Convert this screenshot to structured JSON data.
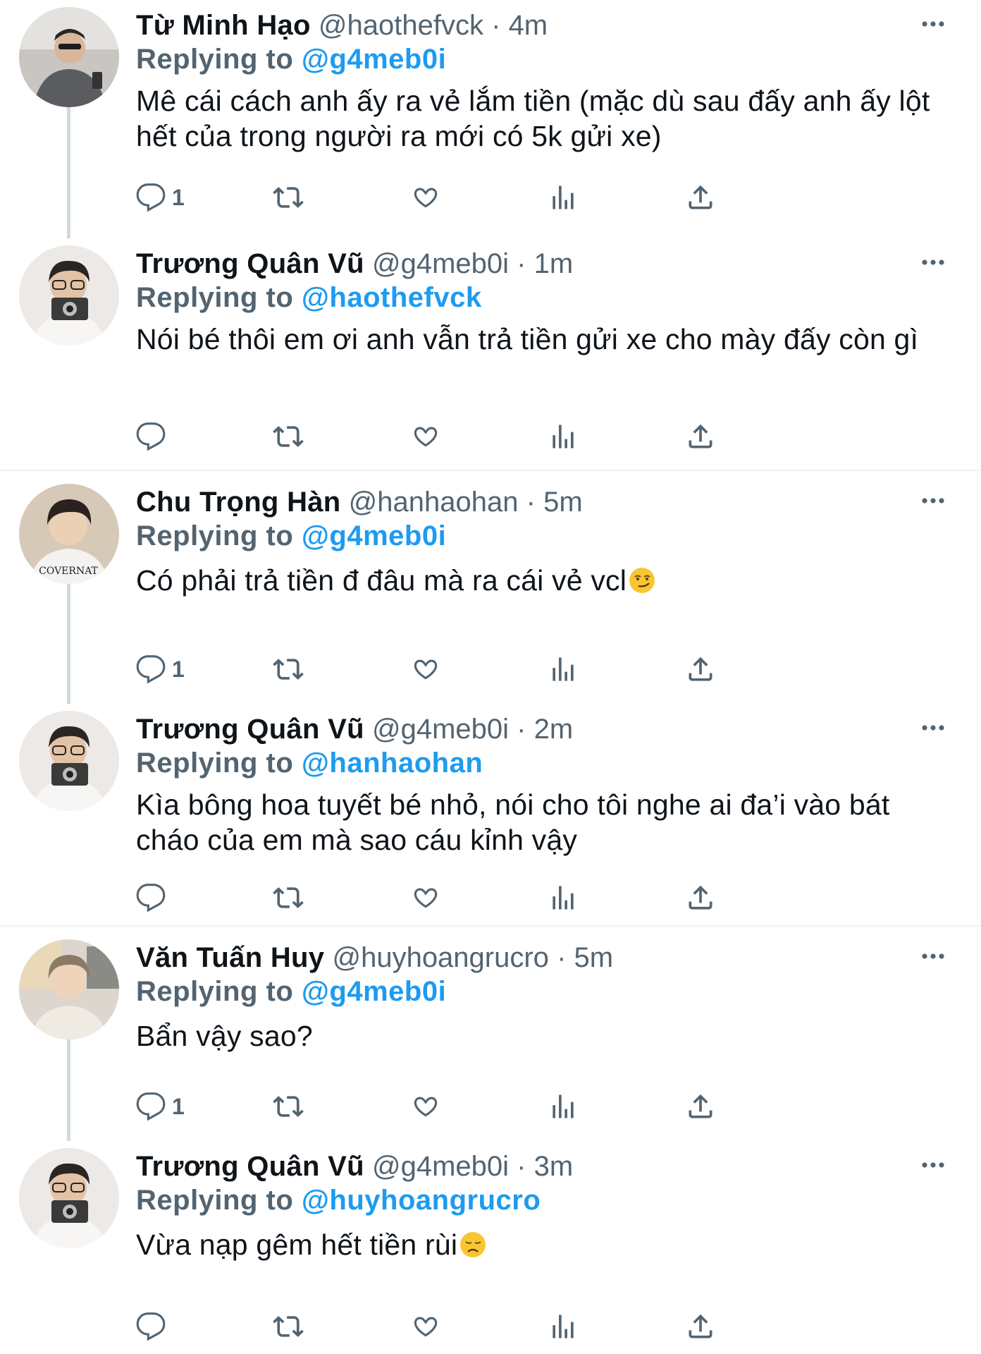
{
  "tweets": [
    {
      "name": "Từ Minh Hạo",
      "handle": "@haothefvck",
      "time": "4m",
      "replying_prefix": "Replying to",
      "replying_handle": "@g4meb0i",
      "text": "Mê cái cách anh ấy ra vẻ lắm tiền (mặc dù sau đấy anh ấy lột hết của trong người ra mới có 5k gửi xe)",
      "reply_count": "1"
    },
    {
      "name": "Trương Quân Vũ",
      "handle": "@g4meb0i",
      "time": "1m",
      "replying_prefix": "Replying to",
      "replying_handle": "@haothefvck",
      "text": "Nói bé thôi em ơi anh vẫn trả tiền gửi xe cho mày đấy còn gì",
      "reply_count": ""
    },
    {
      "name": "Chu Trọng Hàn",
      "handle": "@hanhaohan",
      "time": "5m",
      "replying_prefix": "Replying to",
      "replying_handle": "@g4meb0i",
      "text": "Có phải trả tiền đ đâu mà ra cái vẻ vcl",
      "emoji": "smirking-face",
      "reply_count": "1"
    },
    {
      "name": "Trương Quân Vũ",
      "handle": "@g4meb0i",
      "time": "2m",
      "replying_prefix": "Replying to",
      "replying_handle": "@hanhaohan",
      "text": "Kìa bông hoa tuyết bé nhỏ, nói cho tôi nghe ai đa’i vào bát cháo của em mà sao cáu kỉnh vậy",
      "reply_count": ""
    },
    {
      "name": "Văn Tuấn Huy",
      "handle": "@huyhoangrucro",
      "time": "5m",
      "replying_prefix": "Replying to",
      "replying_handle": "@g4meb0i",
      "text": "Bẩn vậy sao?",
      "reply_count": "1"
    },
    {
      "name": "Trương Quân Vũ",
      "handle": "@g4meb0i",
      "time": "3m",
      "replying_prefix": "Replying to",
      "replying_handle": "@huyhoangrucro",
      "text": "Vừa nạp gêm hết tiền rùi",
      "emoji": "disappointed-face",
      "reply_count": ""
    }
  ],
  "separator": "·",
  "colors": {
    "accent": "#1d9bf0",
    "secondary": "#536471",
    "thread_line": "#cfd9de"
  },
  "icons": [
    "more-icon",
    "reply-icon",
    "retweet-icon",
    "like-icon",
    "views-icon",
    "share-icon"
  ]
}
